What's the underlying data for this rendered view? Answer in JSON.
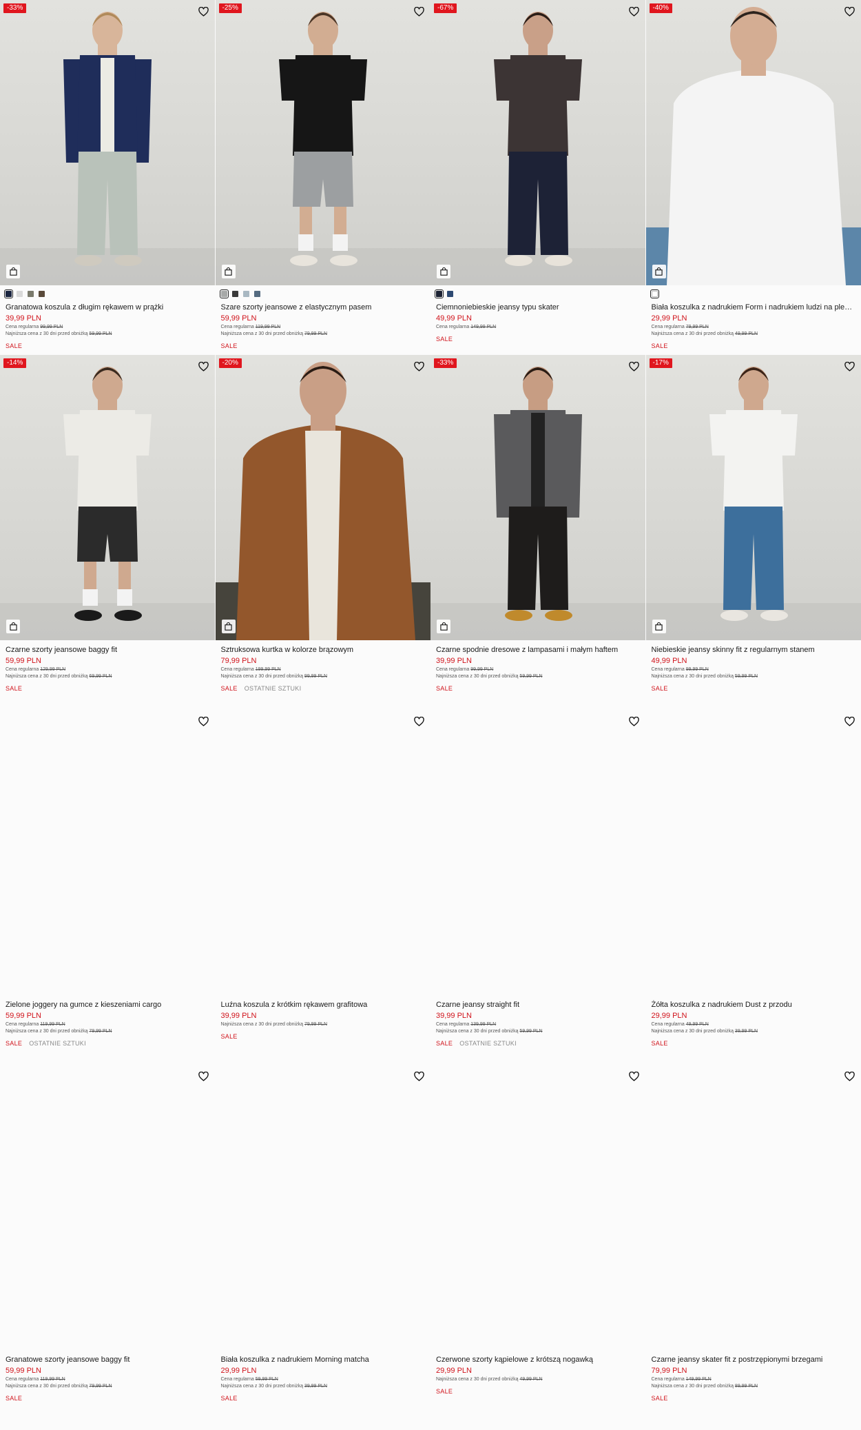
{
  "labels": {
    "regular": "Cena regularna",
    "lowest": "Najniższa cena z 30 dni przed obniżką",
    "sale": "SALE",
    "last_items": "OSTATNIE SZTUKI"
  },
  "colors": {
    "accent": "#d0121a",
    "badge": "#e0161e"
  },
  "products": [
    {
      "name": "Granatowa koszula z długim rękawem w prążki",
      "discount": "-33%",
      "price": "39,99 PLN",
      "regular": "99,99 PLN",
      "lowest": "59,99 PLN",
      "sale": true,
      "last": false,
      "swatches": [
        "#1b2540",
        "#d9d9d9",
        "#7a7a6c",
        "#5a4a3a"
      ],
      "image": "navy-shirt"
    },
    {
      "name": "Szare szorty jeansowe z elastycznym pasem",
      "discount": "-25%",
      "price": "59,99 PLN",
      "regular": "119,99 PLN",
      "lowest": "79,99 PLN",
      "sale": true,
      "last": false,
      "swatches": [
        "#a7a9a8",
        "#3a3a3a",
        "#a9b8c2",
        "#556b80"
      ],
      "image": "grey-shorts"
    },
    {
      "name": "Ciemnoniebieskie jeansy typu skater",
      "discount": "-67%",
      "price": "49,99 PLN",
      "regular": "149,99 PLN",
      "lowest": null,
      "sale": true,
      "last": false,
      "swatches": [
        "#1c2233",
        "#2e4a72"
      ],
      "image": "skater-jeans"
    },
    {
      "name": "Biała koszulka z nadrukiem Form i nadrukiem ludzi na plecach",
      "discount": "-40%",
      "price": "29,99 PLN",
      "regular": "79,99 PLN",
      "lowest": "49,99 PLN",
      "sale": true,
      "last": false,
      "swatches": [
        "#ffffff"
      ],
      "image": "form-tee"
    },
    {
      "name": "Czarne szorty jeansowe baggy fit",
      "discount": "-14%",
      "price": "59,99 PLN",
      "regular": "129,99 PLN",
      "lowest": "69,99 PLN",
      "sale": true,
      "last": false,
      "swatches": [],
      "image": "black-shorts"
    },
    {
      "name": "Sztruksowa kurtka w kolorze brązowym",
      "discount": "-20%",
      "price": "79,99 PLN",
      "regular": "199,99 PLN",
      "lowest": "99,99 PLN",
      "sale": true,
      "last": true,
      "swatches": [],
      "image": "brown-jacket"
    },
    {
      "name": "Czarne spodnie dresowe z lampasami i małym haftem",
      "discount": "-33%",
      "price": "39,99 PLN",
      "regular": "99,99 PLN",
      "lowest": "59,99 PLN",
      "sale": true,
      "last": false,
      "swatches": [],
      "image": "camo-bomber"
    },
    {
      "name": "Niebieskie jeansy skinny fit z regularnym stanem",
      "discount": "-17%",
      "price": "49,99 PLN",
      "regular": "99,99 PLN",
      "lowest": "59,99 PLN",
      "sale": true,
      "last": false,
      "swatches": [],
      "image": "blue-skinny"
    },
    {
      "name": "Zielone joggery na gumce z kieszeniami cargo",
      "discount": null,
      "price": "59,99 PLN",
      "regular": "119,99 PLN",
      "lowest": "79,99 PLN",
      "sale": true,
      "last": true,
      "swatches": [],
      "image": null
    },
    {
      "name": "Luźna koszula z krótkim rękawem grafitowa",
      "discount": null,
      "price": "39,99 PLN",
      "regular": null,
      "lowest": "79,99 PLN",
      "sale": true,
      "last": false,
      "swatches": [],
      "image": null
    },
    {
      "name": "Czarne jeansy straight fit",
      "discount": null,
      "price": "39,99 PLN",
      "regular": "139,99 PLN",
      "lowest": "59,99 PLN",
      "sale": true,
      "last": true,
      "swatches": [],
      "image": null
    },
    {
      "name": "Żółta koszulka z nadrukiem Dust z przodu",
      "discount": null,
      "price": "29,99 PLN",
      "regular": "49,99 PLN",
      "lowest": "39,99 PLN",
      "sale": true,
      "last": false,
      "swatches": [],
      "image": null
    },
    {
      "name": "Granatowe szorty jeansowe baggy fit",
      "discount": null,
      "price": "59,99 PLN",
      "regular": "119,99 PLN",
      "lowest": "79,99 PLN",
      "sale": true,
      "last": false,
      "swatches": [],
      "image": null
    },
    {
      "name": "Biała koszulka z nadrukiem Morning matcha",
      "discount": null,
      "price": "29,99 PLN",
      "regular": "59,99 PLN",
      "lowest": "39,99 PLN",
      "sale": true,
      "last": false,
      "swatches": [],
      "image": null
    },
    {
      "name": "Czerwone szorty kąpielowe z krótszą nogawką",
      "discount": null,
      "price": "29,99 PLN",
      "regular": null,
      "lowest": "49,99 PLN",
      "sale": true,
      "last": false,
      "swatches": [],
      "image": null
    },
    {
      "name": "Czarne jeansy skater fit z postrzępionymi brzegami",
      "discount": null,
      "price": "79,99 PLN",
      "regular": "149,99 PLN",
      "lowest": "89,99 PLN",
      "sale": true,
      "last": false,
      "swatches": [],
      "image": null
    }
  ]
}
